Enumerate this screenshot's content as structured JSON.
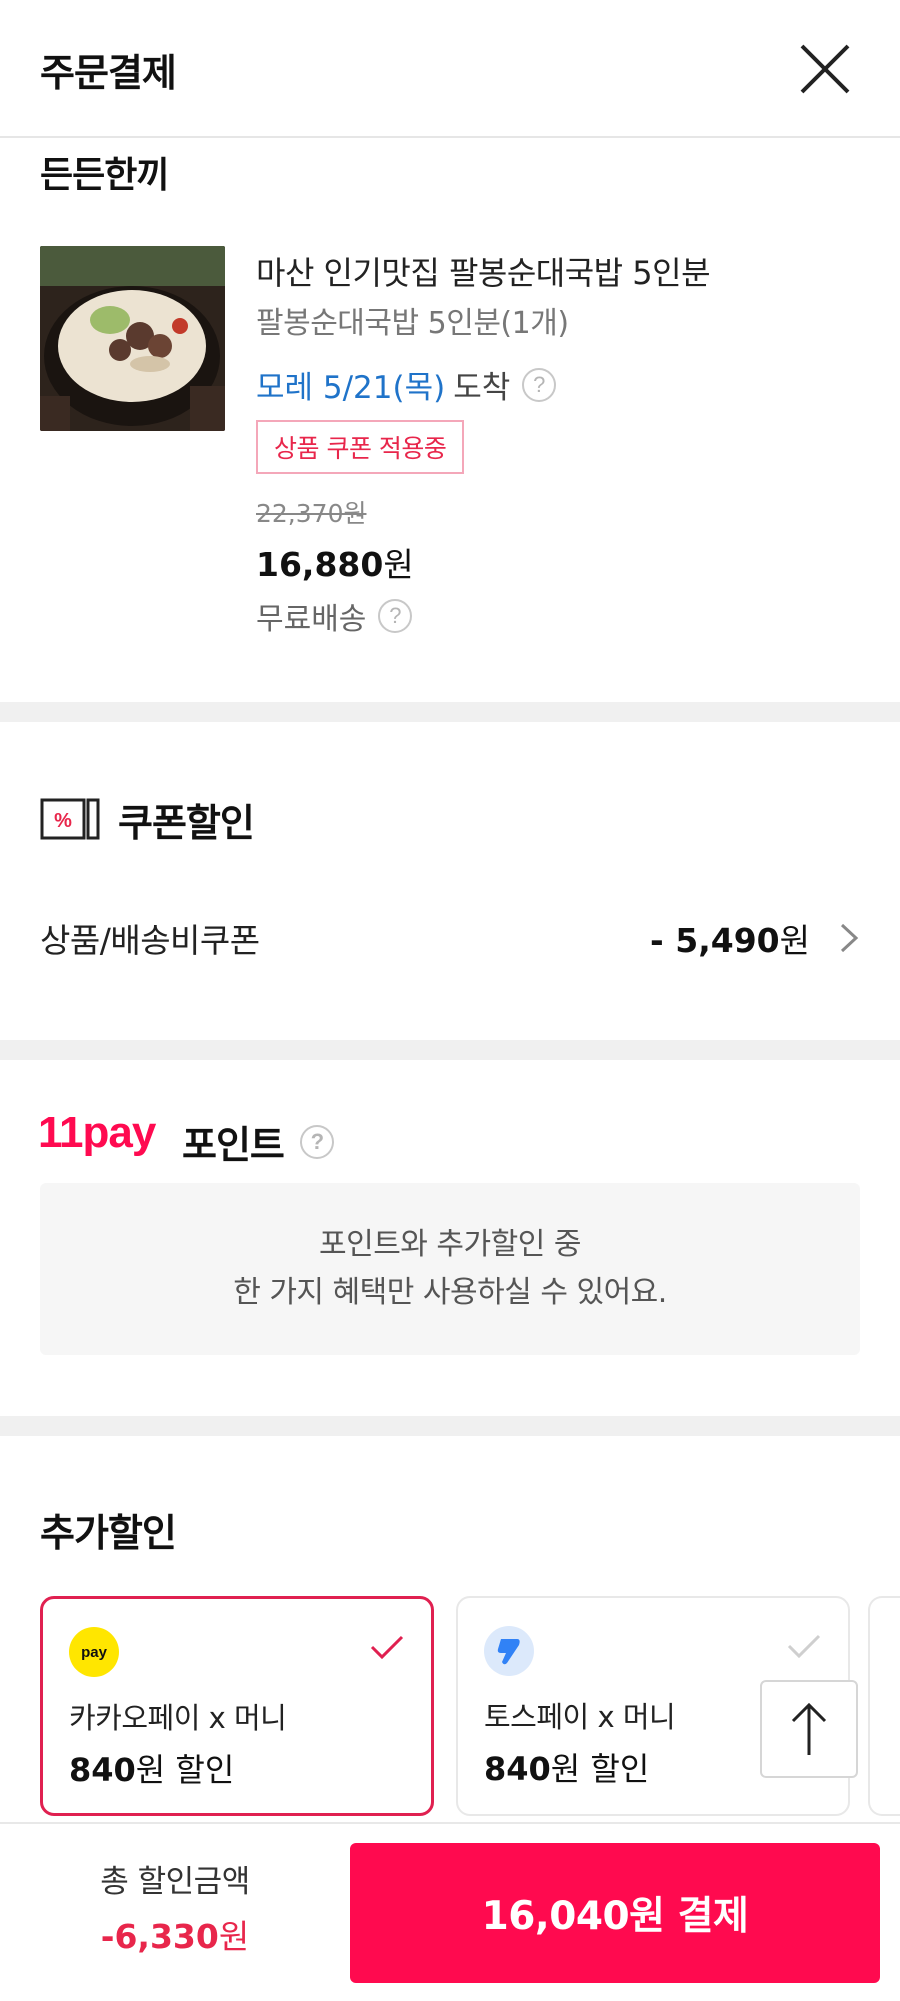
{
  "header": {
    "title": "주문결제"
  },
  "seller": {
    "name": "든든한끼"
  },
  "product": {
    "name": "마산 인기맛집 팔봉순대국밥 5인분",
    "option": "팔봉순대국밥 5인분(1개)",
    "delivery_date": "모레 5/21(목)",
    "delivery_suffix": "도착",
    "coupon_tag": "상품 쿠폰 적용중",
    "original_price": "22,370원",
    "sale_price_number": "16,880",
    "sale_price_unit": "원",
    "shipping": "무료배송"
  },
  "coupon_section": {
    "title": "쿠폰할인",
    "icon_glyph": "%",
    "row_label": "상품/배송비쿠폰",
    "row_amount_number": "- 5,490",
    "row_amount_unit": "원"
  },
  "point_section": {
    "logo": "11pay",
    "title": "포인트",
    "notice_line1": "포인트와 추가할인 중",
    "notice_line2": "한 가지 혜택만 사용하실 수 있어요."
  },
  "extra_discount": {
    "title": "추가할인",
    "cards": [
      {
        "logo_text": "pay",
        "name": "카카오페이 x 머니",
        "amount_number": "840",
        "amount_suffix": "원 할인",
        "selected": true
      },
      {
        "name": "토스페이 x 머니",
        "amount_number": "840",
        "amount_suffix": "원 할인",
        "selected": false
      }
    ]
  },
  "footer": {
    "total_label": "총 할인금액",
    "total_amount_number": "-6,330",
    "total_amount_unit": "원",
    "pay_button": "16,040원 결제"
  },
  "colors": {
    "brand": "#ff0a50",
    "discount_text": "#e8264b",
    "delivery_blue": "#1f73c9",
    "kakao_yellow": "#ffe600",
    "toss_blue": "#3182f6"
  }
}
